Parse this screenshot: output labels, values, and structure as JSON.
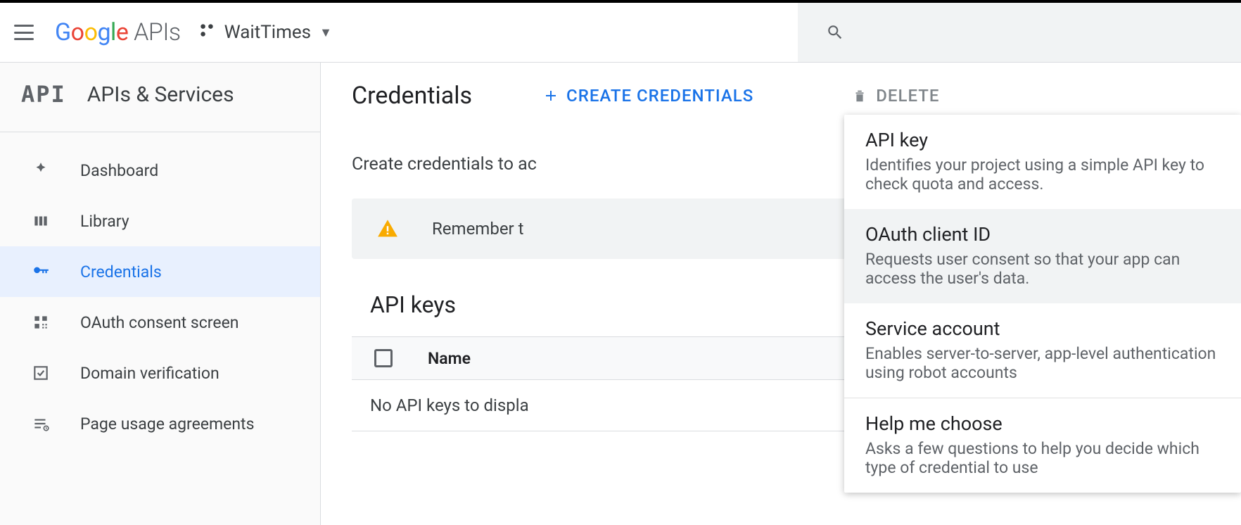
{
  "header": {
    "logo_text": "Google",
    "logo_suffix": " APIs",
    "project_name": "WaitTimes"
  },
  "sidebar": {
    "title": "APIs & Services",
    "items": [
      {
        "label": "Dashboard",
        "icon": "dashboard",
        "active": false
      },
      {
        "label": "Library",
        "icon": "library",
        "active": false
      },
      {
        "label": "Credentials",
        "icon": "key",
        "active": true
      },
      {
        "label": "OAuth consent screen",
        "icon": "consent",
        "active": false
      },
      {
        "label": "Domain verification",
        "icon": "verify",
        "active": false
      },
      {
        "label": "Page usage agreements",
        "icon": "agreement",
        "active": false
      }
    ]
  },
  "main": {
    "title": "Credentials",
    "create_label": "CREATE CREDENTIALS",
    "delete_label": "DELETE",
    "subtitle": "Create credentials to ac",
    "banner_text": "Remember t",
    "section_title": "API keys",
    "table": {
      "col_name": "Name",
      "empty_text": "No API keys to displa"
    }
  },
  "dropdown": {
    "items": [
      {
        "title": "API key",
        "desc": "Identifies your project using a simple API key to check quota and access."
      },
      {
        "title": "OAuth client ID",
        "desc": "Requests user consent so that your app can access the user's data."
      },
      {
        "title": "Service account",
        "desc": "Enables server-to-server, app-level authentication using robot accounts"
      }
    ],
    "help": {
      "title": "Help me choose",
      "desc": "Asks a few questions to help you decide which type of credential to use"
    }
  }
}
